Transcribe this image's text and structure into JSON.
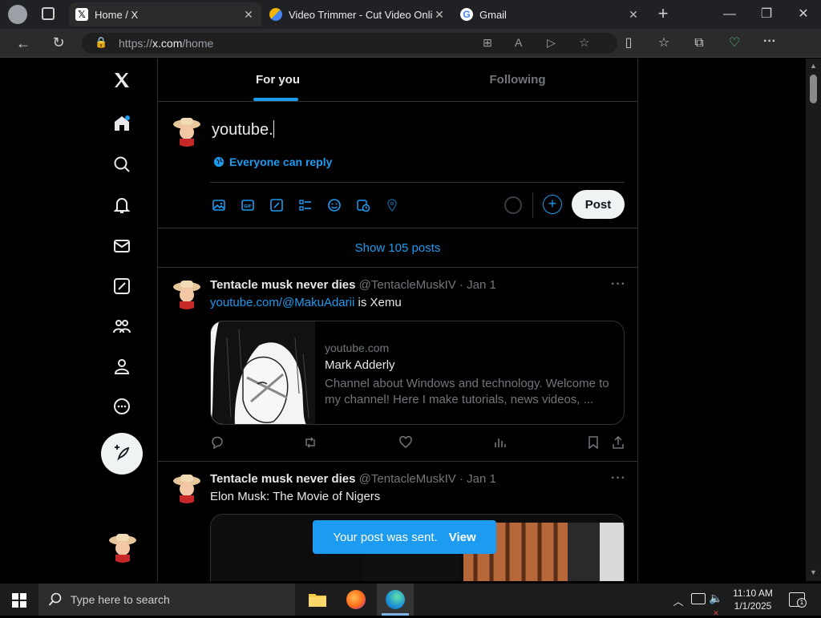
{
  "browser": {
    "tabs": [
      {
        "title": "Home / X",
        "active": true
      },
      {
        "title": "Video Trimmer - Cut Video Online",
        "active": false
      },
      {
        "title": "Gmail",
        "active": false
      }
    ],
    "url_scheme": "https://",
    "url_host": "x.com",
    "url_path": "/home"
  },
  "x": {
    "feed_tabs": {
      "for_you": "For you",
      "following": "Following"
    },
    "composer": {
      "text": "youtube.",
      "reply_setting": "Everyone can reply",
      "post_label": "Post"
    },
    "show_posts": "Show 105 posts",
    "tweets": [
      {
        "name": "Tentacle musk never dies",
        "handle": "@TentacleMuskIV",
        "date": "· Jan 1",
        "link": "youtube.com/@MakuAdarii",
        "text_after_link": " is Xemu",
        "card": {
          "domain": "youtube.com",
          "title": "Mark Adderly",
          "description": "Channel about Windows and technology. Welcome to my channel! Here I make tutorials, news videos, ..."
        }
      },
      {
        "name": "Tentacle musk never dies",
        "handle": "@TentacleMuskIV",
        "date": "· Jan 1",
        "text": "Elon Musk: The Movie of Nigers"
      }
    ],
    "toast": {
      "message": "Your post was sent.",
      "action": "View"
    }
  },
  "taskbar": {
    "search_placeholder": "Type here to search",
    "time": "11:10 AM",
    "date": "1/1/2025",
    "notification_count": "1"
  },
  "colors": {
    "accent": "#1d9bf0",
    "background": "#000000",
    "border": "#2f3336",
    "muted_text": "#71767b"
  }
}
